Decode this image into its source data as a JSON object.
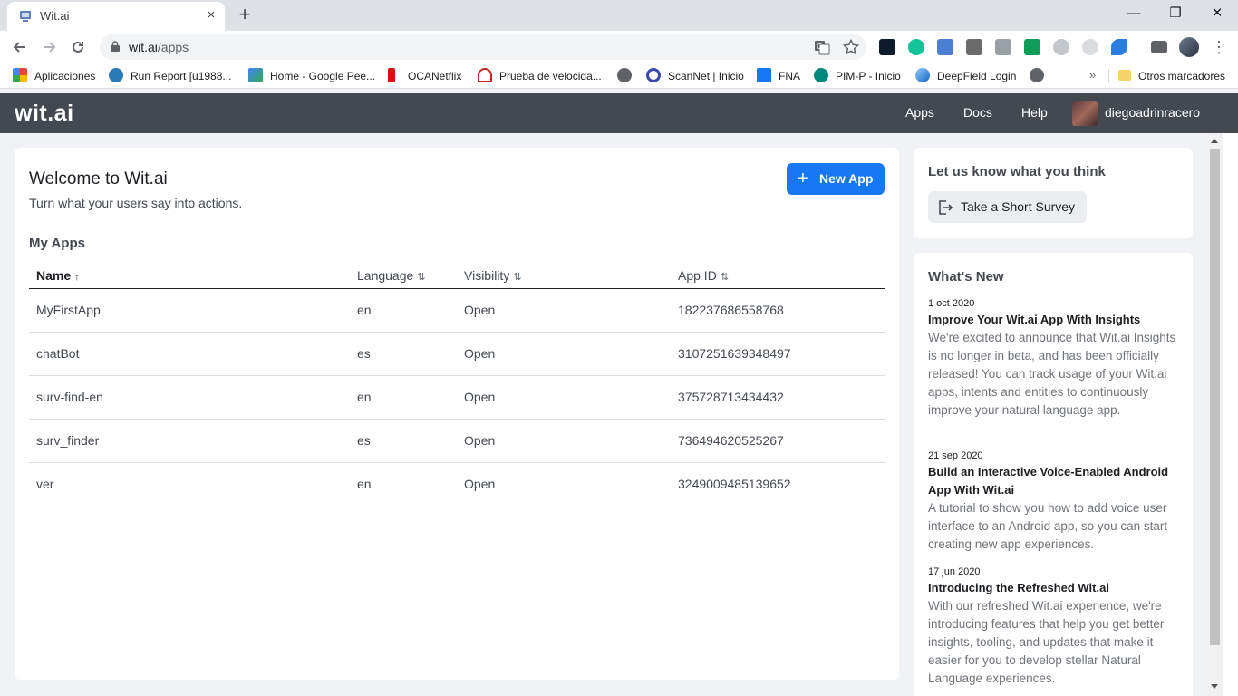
{
  "browser": {
    "tab_title": "Wit.ai",
    "close_tab": "×",
    "new_tab": "+",
    "window": {
      "minimize": "—",
      "restore": "❐",
      "close": "✕"
    },
    "url_host": "wit.ai",
    "url_path": "/apps",
    "bookmarks": [
      {
        "label": "Aplicaciones",
        "icon": "apps-grid-icon",
        "color": "#4285f4"
      },
      {
        "label": "Run Report [u1988...",
        "icon": "ca-logo-icon",
        "color": "#2a7ab8"
      },
      {
        "label": "Home - Google Pee...",
        "icon": "google-peering-icon",
        "color": "#34a853"
      },
      {
        "label": "OCANetflix",
        "icon": "netflix-icon",
        "color": "#e50914"
      },
      {
        "label": "Prueba de velocida...",
        "icon": "speedometer-icon",
        "color": "#c62828"
      },
      {
        "label": "",
        "icon": "globe-icon",
        "color": "#5f6368"
      },
      {
        "label": "ScanNet | Inicio",
        "icon": "scannet-icon",
        "color": "#3949ab"
      },
      {
        "label": "FNA",
        "icon": "facebook-icon",
        "color": "#1877f2"
      },
      {
        "label": "PIM-P - Inicio",
        "icon": "pim-icon",
        "color": "#00897b"
      },
      {
        "label": "DeepField Login",
        "icon": "deepfield-icon",
        "color": "#1565c0"
      },
      {
        "label": "",
        "icon": "globe-icon",
        "color": "#5f6368"
      }
    ],
    "more_bookmarks": "»",
    "other_bookmarks": "Otros marcadores"
  },
  "header": {
    "logo": "wit.ai",
    "nav": [
      "Apps",
      "Docs",
      "Help"
    ],
    "username": "diegoadrinracero"
  },
  "main": {
    "title": "Welcome to Wit.ai",
    "subtitle": "Turn what your users say into actions.",
    "new_app_label": "New App",
    "section_title": "My Apps",
    "columns": [
      {
        "label": "Name",
        "sort": "↑",
        "active": true
      },
      {
        "label": "Language",
        "sort": "⇅",
        "active": false
      },
      {
        "label": "Visibility",
        "sort": "⇅",
        "active": false
      },
      {
        "label": "App ID",
        "sort": "⇅",
        "active": false
      }
    ],
    "rows": [
      {
        "name": "MyFirstApp",
        "language": "en",
        "visibility": "Open",
        "app_id": "182237686558768"
      },
      {
        "name": "chatBot",
        "language": "es",
        "visibility": "Open",
        "app_id": "3107251639348497"
      },
      {
        "name": "surv-find-en",
        "language": "en",
        "visibility": "Open",
        "app_id": "375728713434432"
      },
      {
        "name": "surv_finder",
        "language": "es",
        "visibility": "Open",
        "app_id": "736494620525267"
      },
      {
        "name": "ver",
        "language": "en",
        "visibility": "Open",
        "app_id": "3249009485139652"
      }
    ]
  },
  "survey": {
    "title": "Let us know what you think",
    "button": "Take a Short Survey"
  },
  "news": {
    "title": "What's New",
    "items": [
      {
        "date": "1 oct 2020",
        "headline": "Improve Your Wit.ai App With Insights",
        "body": "We're excited to announce that Wit.ai Insights is no longer in beta, and has been officially released! You can track usage of your Wit.ai apps, intents and entities to continuously improve your natural language app."
      },
      {
        "date": "21 sep 2020",
        "headline": "Build an Interactive Voice-Enabled Android App With Wit.ai",
        "body": "A tutorial to show you how to add voice user interface to an Android app, so you can start creating new app experiences."
      },
      {
        "date": "17 jun 2020",
        "headline": "Introducing the Refreshed Wit.ai",
        "body": "With our refreshed Wit.ai experience, we're introducing features that help you get better insights, tooling, and updates that make it easier for you to develop stellar Natural Language experiences."
      }
    ]
  },
  "colors": {
    "header_bg": "#444950",
    "primary_button": "#1877f2",
    "page_bg": "#f0f2f5"
  }
}
